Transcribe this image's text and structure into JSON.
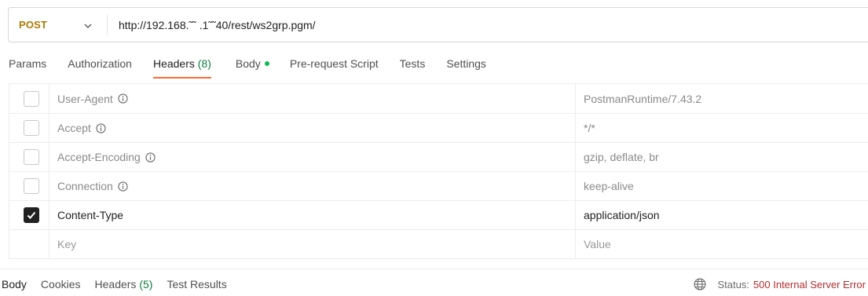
{
  "request": {
    "method": "POST",
    "url": "http://192.168.˜˜ .1˜˜40/rest/ws2grp.pgm/"
  },
  "request_tabs": [
    {
      "label": "Params"
    },
    {
      "label": "Authorization"
    },
    {
      "label": "Headers",
      "count": "(8)",
      "active": true
    },
    {
      "label": "Body",
      "has_dot": true
    },
    {
      "label": "Pre-request Script"
    },
    {
      "label": "Tests"
    },
    {
      "label": "Settings"
    }
  ],
  "headers": [
    {
      "key": "User-Agent",
      "value": "PostmanRuntime/7.43.2",
      "checked": false,
      "info": true
    },
    {
      "key": "Accept",
      "value": "*/*",
      "checked": false,
      "info": true
    },
    {
      "key": "Accept-Encoding",
      "value": "gzip, deflate, br",
      "checked": false,
      "info": true
    },
    {
      "key": "Connection",
      "value": "keep-alive",
      "checked": false,
      "info": true
    },
    {
      "key": "Content-Type",
      "value": "application/json",
      "checked": true,
      "info": false
    }
  ],
  "new_row": {
    "key_placeholder": "Key",
    "value_placeholder": "Value"
  },
  "response_tabs": [
    {
      "label": "Body",
      "active": true
    },
    {
      "label": "Cookies"
    },
    {
      "label": "Headers",
      "count": "(5)"
    },
    {
      "label": "Test Results"
    }
  ],
  "status": {
    "label": "Status:",
    "code": "500 Internal Server Error",
    "icon": "globe-icon"
  },
  "colors": {
    "method": "#ad7a03",
    "accent": "#ff6c37",
    "count": "#0f7d3f",
    "error": "#b42d2d"
  }
}
